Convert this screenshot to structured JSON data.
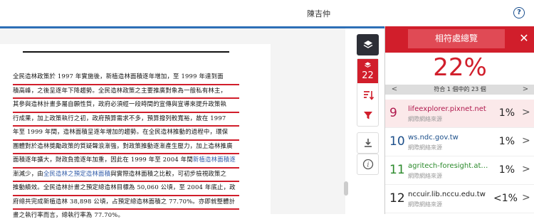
{
  "header": {
    "user_name": "陳吉仲",
    "help_symbol": "?"
  },
  "document": {
    "lines": [
      {
        "pre": "全民造林政策於 1997 年實施後，新植造林面積逐年增加，至 1999 年達到面",
        "hl": "",
        "post": ""
      },
      {
        "pre": "積高峰，之後呈逐年下降趨勢。全民造林政策之主要推廣對象為一般私有林主，",
        "hl": "",
        "post": ""
      },
      {
        "pre": "其參與造林計畫多屬自願性質，政府必須經一段時間的宣傳與宣導來提升政策執",
        "hl": "",
        "post": ""
      },
      {
        "pre": "行成果，加上政策執行之初，政府預算需求不多，預算撥列較寬裕，故在 1997",
        "hl": "",
        "post": ""
      },
      {
        "pre": "年至 1999 年間，造林面積呈逐年增加的趨勢。在全民造林推動的過程中，環保",
        "hl": "",
        "post": ""
      },
      {
        "pre": "團體對於造林獎勵政策的質疑聲浪漸強，對政策推動逐漸產生壓力，加上造林推廣",
        "hl": "",
        "post": ""
      },
      {
        "pre": "面積逐年擴大，財政負擔逐年加重，因此在 1999 年至 2004 年間",
        "hl": "新植造林面積逐",
        "post": ""
      },
      {
        "pre": "漸減少，由",
        "hl": "全民造林之預定造林面積",
        "post": "與實際造林面積之比較，可初步檢視政策之"
      },
      {
        "pre": "推動績效。全民造林計畫之預定總造林目標為 50,060 公頃，至 2004 年底止，政",
        "hl": "",
        "post": ""
      },
      {
        "pre": "府總共完成新植造林 38,898 公頃，占預定總造林面積之 77.70%。亦即就整體計",
        "hl": "",
        "post": ""
      },
      {
        "pre": "畫之執行率而言，總執行率為 77.70%。",
        "hl": "",
        "post": ""
      }
    ]
  },
  "toolbar": {
    "layers_icon": "layers-icon",
    "match_count": "22",
    "sort_icon": "sort-icon",
    "filter_icon": "filter-icon",
    "download_icon": "download-icon",
    "info_icon": "info-icon"
  },
  "panel": {
    "title": "相符處總覽",
    "close_symbol": "✕",
    "percentage": "22%",
    "nav_text": "符合 1 個中的 23 個",
    "prev_symbol": "<",
    "next_symbol": ">",
    "sources": [
      {
        "num": "9",
        "url": "lifeexplorer.pixnet.net",
        "kind": "網際網絡來源",
        "pct": "1%",
        "color": "#b0194d",
        "chev": ">"
      },
      {
        "num": "10",
        "url": "ws.ndc.gov.tw",
        "kind": "網際網絡來源",
        "pct": "1%",
        "color": "#1c4f8a",
        "chev": ">"
      },
      {
        "num": "11",
        "url": "agritech-foresight.atri...",
        "kind": "網際網絡來源",
        "pct": "1%",
        "color": "#2b8a2b",
        "chev": ">"
      },
      {
        "num": "12",
        "url": "nccuir.lib.nccu.edu.tw",
        "kind": "網際網絡來源",
        "pct": "<1%",
        "color": "#222222",
        "chev": ">"
      }
    ]
  },
  "colors": {
    "accent_red": "#d11e2b",
    "header_blue": "#2d6fb6",
    "dark_button": "#2d2f37"
  }
}
